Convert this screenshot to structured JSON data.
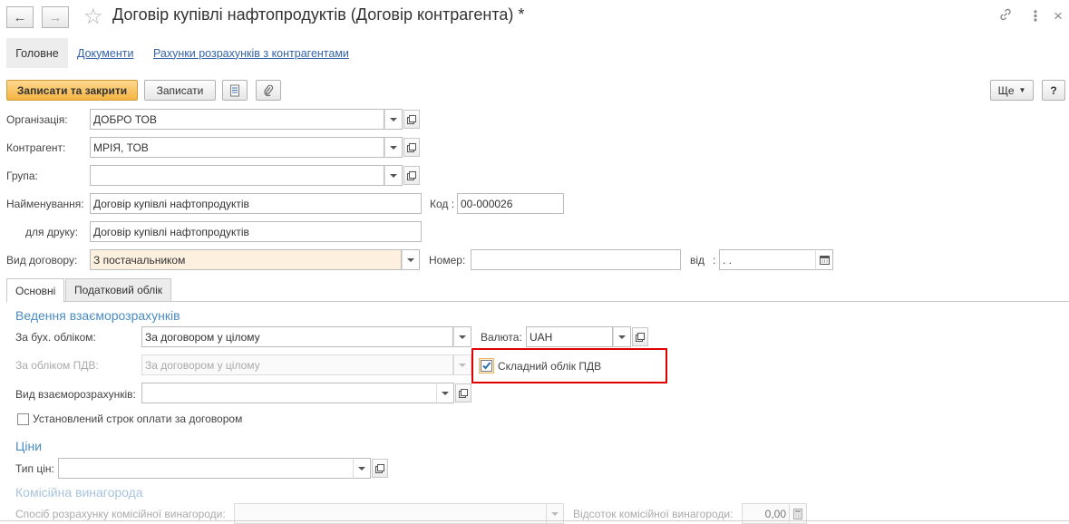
{
  "window": {
    "title": "Договір купівлі нафтопродуктів (Договір контрагента) *",
    "nav_back_icon": "arrow-left-icon",
    "nav_forward_icon": "arrow-right-icon",
    "favorite_icon": "star-icon"
  },
  "tabs": [
    {
      "label": "Головне"
    },
    {
      "label": "Документи"
    },
    {
      "label": "Рахунки розрахунків з контрагентами"
    }
  ],
  "toolbar": {
    "save_close_label": "Записати та закрити",
    "save_label": "Записати",
    "more_label": "Ще",
    "help_label": "?"
  },
  "form": {
    "organization": {
      "label": "Організація:",
      "value": "ДОБРО ТОВ"
    },
    "counterparty": {
      "label": "Контрагент:",
      "value": "МРІЯ, ТОВ"
    },
    "group": {
      "label": "Група:",
      "value": ""
    },
    "name": {
      "label": "Найменування:",
      "value": "Договір купівлі нафтопродуктів"
    },
    "code": {
      "label": "Код :",
      "value": "00-000026"
    },
    "print_name": {
      "label": "для друку:",
      "value": "Договір купівлі нафтопродуктів"
    },
    "contract_type": {
      "label": "Вид договору:",
      "value": "З постачальником"
    },
    "number": {
      "label": "Номер:",
      "value": ""
    },
    "date": {
      "label": "від",
      "colon": ":",
      "value": " .  ."
    }
  },
  "inner_tabs": [
    {
      "label": "Основні"
    },
    {
      "label": "Податковий облік"
    }
  ],
  "settlements": {
    "title": "Ведення взаєморозрахунків",
    "accounting": {
      "label": "За бух. обліком:",
      "value": "За договором у цілому"
    },
    "currency": {
      "label": "Валюта:",
      "value": "UAH"
    },
    "vat": {
      "label": "За обліком ПДВ:",
      "value": "За договором у цілому"
    },
    "complex_vat": {
      "label": "Складний облік ПДВ",
      "checked": true
    },
    "settlement_type": {
      "label": "Вид взаєморозрахунків:",
      "value": ""
    },
    "payment_term": {
      "label": "Установлений строк оплати за договором",
      "checked": false
    }
  },
  "prices": {
    "title": "Ціни",
    "price_type": {
      "label": "Тип цін:",
      "value": ""
    }
  },
  "commission": {
    "title": "Комісійна винагорода",
    "method": {
      "label": "Спосіб розрахунку комісійної винагороди:",
      "value": ""
    },
    "percent": {
      "label": "Відсоток комісійної винагороди:",
      "value": "0,00"
    }
  },
  "colors": {
    "accent": "#4a8cc4",
    "primary_button": "#f4b443",
    "highlight_field": "#fdf0de",
    "callout_border": "#e00000"
  }
}
